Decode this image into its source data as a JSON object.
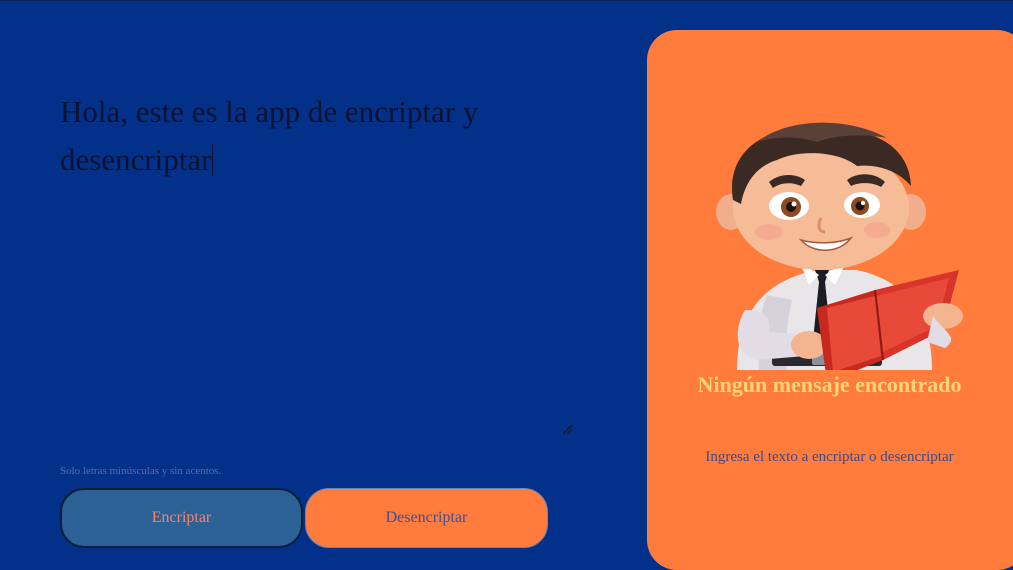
{
  "input": {
    "value": "Hola, este es la app de encriptar y desencriptar"
  },
  "hint": "Solo letras minúsculas y sin acentos.",
  "buttons": {
    "encrypt": "Encriptar",
    "decrypt": "Desencriptar"
  },
  "result_panel": {
    "illustration": "boy-reading-book-illustration",
    "title": "Ningún mensaje encontrado",
    "subtitle": "Ingresa el texto a encriptar o desencriptar"
  },
  "colors": {
    "background": "#03318a",
    "panel": "#ff7c3d",
    "encrypt_button": "#2c6195",
    "title_text": "#fed47b"
  }
}
